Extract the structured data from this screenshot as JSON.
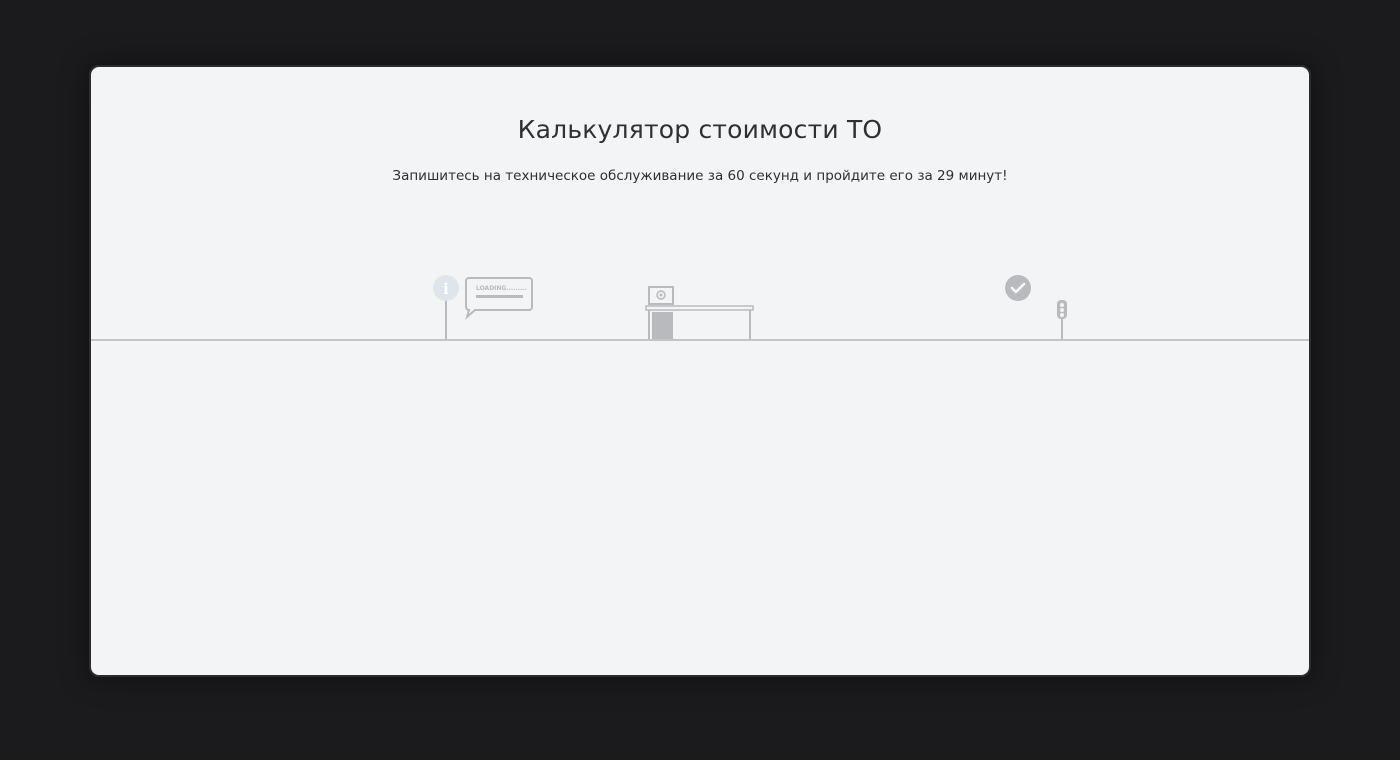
{
  "calculator": {
    "title": "Калькулятор стоимости ТО",
    "subtitle": "Запишитесь на техническое обслуживание за 60 секунд и пройдите его за 29 минут!"
  },
  "scene": {
    "loading_label": "LOADING.........",
    "icons": [
      "info-icon",
      "loading-speech-bubble",
      "service-station-icon",
      "check-icon",
      "traffic-light-icon"
    ]
  },
  "colors": {
    "background": "#1b1b1e",
    "panel": "#f3f4f6",
    "text": "#2f2f34",
    "road": "#c3c4c8",
    "icon_gray": "#b8babe",
    "info_light": "#dfe5ec"
  }
}
